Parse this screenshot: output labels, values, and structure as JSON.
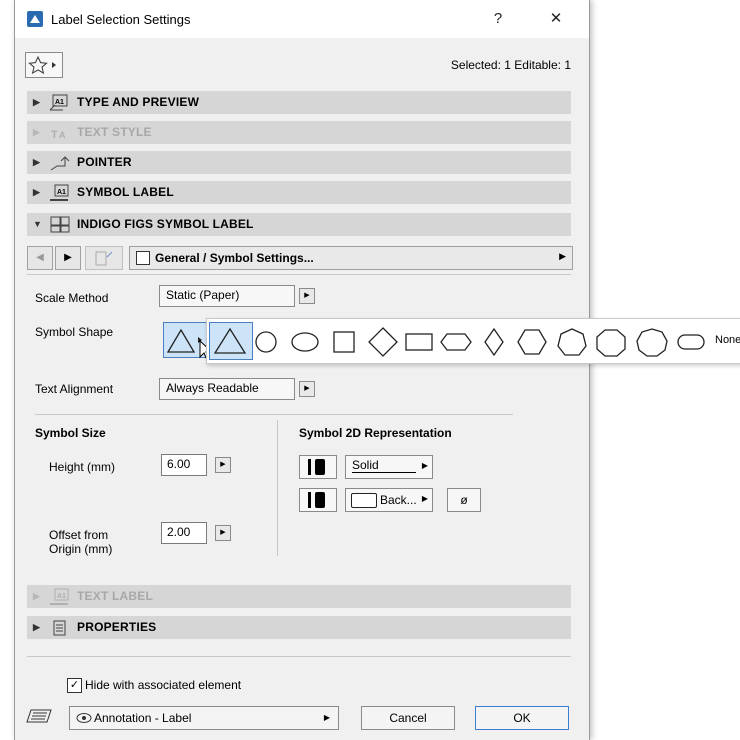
{
  "window": {
    "title": "Label Selection Settings",
    "help": "?",
    "close": "✕"
  },
  "selection_info": "Selected: 1 Editable: 1",
  "panels": [
    {
      "label": "TYPE AND PREVIEW",
      "state": "collapsed"
    },
    {
      "label": "TEXT STYLE",
      "state": "disabled"
    },
    {
      "label": "POINTER",
      "state": "collapsed"
    },
    {
      "label": "SYMBOL LABEL",
      "state": "collapsed"
    },
    {
      "label": "INDIGO FIGS SYMBOL LABEL",
      "state": "expanded"
    },
    {
      "label": "TEXT LABEL",
      "state": "disabled"
    },
    {
      "label": "PROPERTIES",
      "state": "collapsed"
    }
  ],
  "page_nav": {
    "page_label": "General / Symbol Settings..."
  },
  "scale_method": {
    "label": "Scale Method",
    "value": "Static (Paper)"
  },
  "symbol_shape": {
    "label": "Symbol Shape",
    "selected": "triangle",
    "options": [
      "triangle",
      "circle",
      "ellipse",
      "square",
      "diamond",
      "rectangle",
      "hexagon-flat",
      "rhombus",
      "hexagon",
      "heptagon",
      "octagon",
      "nonagon",
      "rounded-rectangle"
    ],
    "none_label": "None"
  },
  "text_alignment": {
    "label": "Text Alignment",
    "value": "Always Readable"
  },
  "symbol_size": {
    "heading": "Symbol Size",
    "height_label": "Height (mm)",
    "height_value": "6.00",
    "offset_label_1": "Offset from",
    "offset_label_2": "Origin (mm)",
    "offset_value": "2.00"
  },
  "representation": {
    "heading": "Symbol 2D Representation",
    "fill_label": "Solid",
    "background_label": "Back...",
    "none_symbol": "ø"
  },
  "hide_checkbox": {
    "label": "Hide with associated element",
    "checked": true
  },
  "footer": {
    "layer_label": "Annotation - Label",
    "cancel": "Cancel",
    "ok": "OK"
  }
}
